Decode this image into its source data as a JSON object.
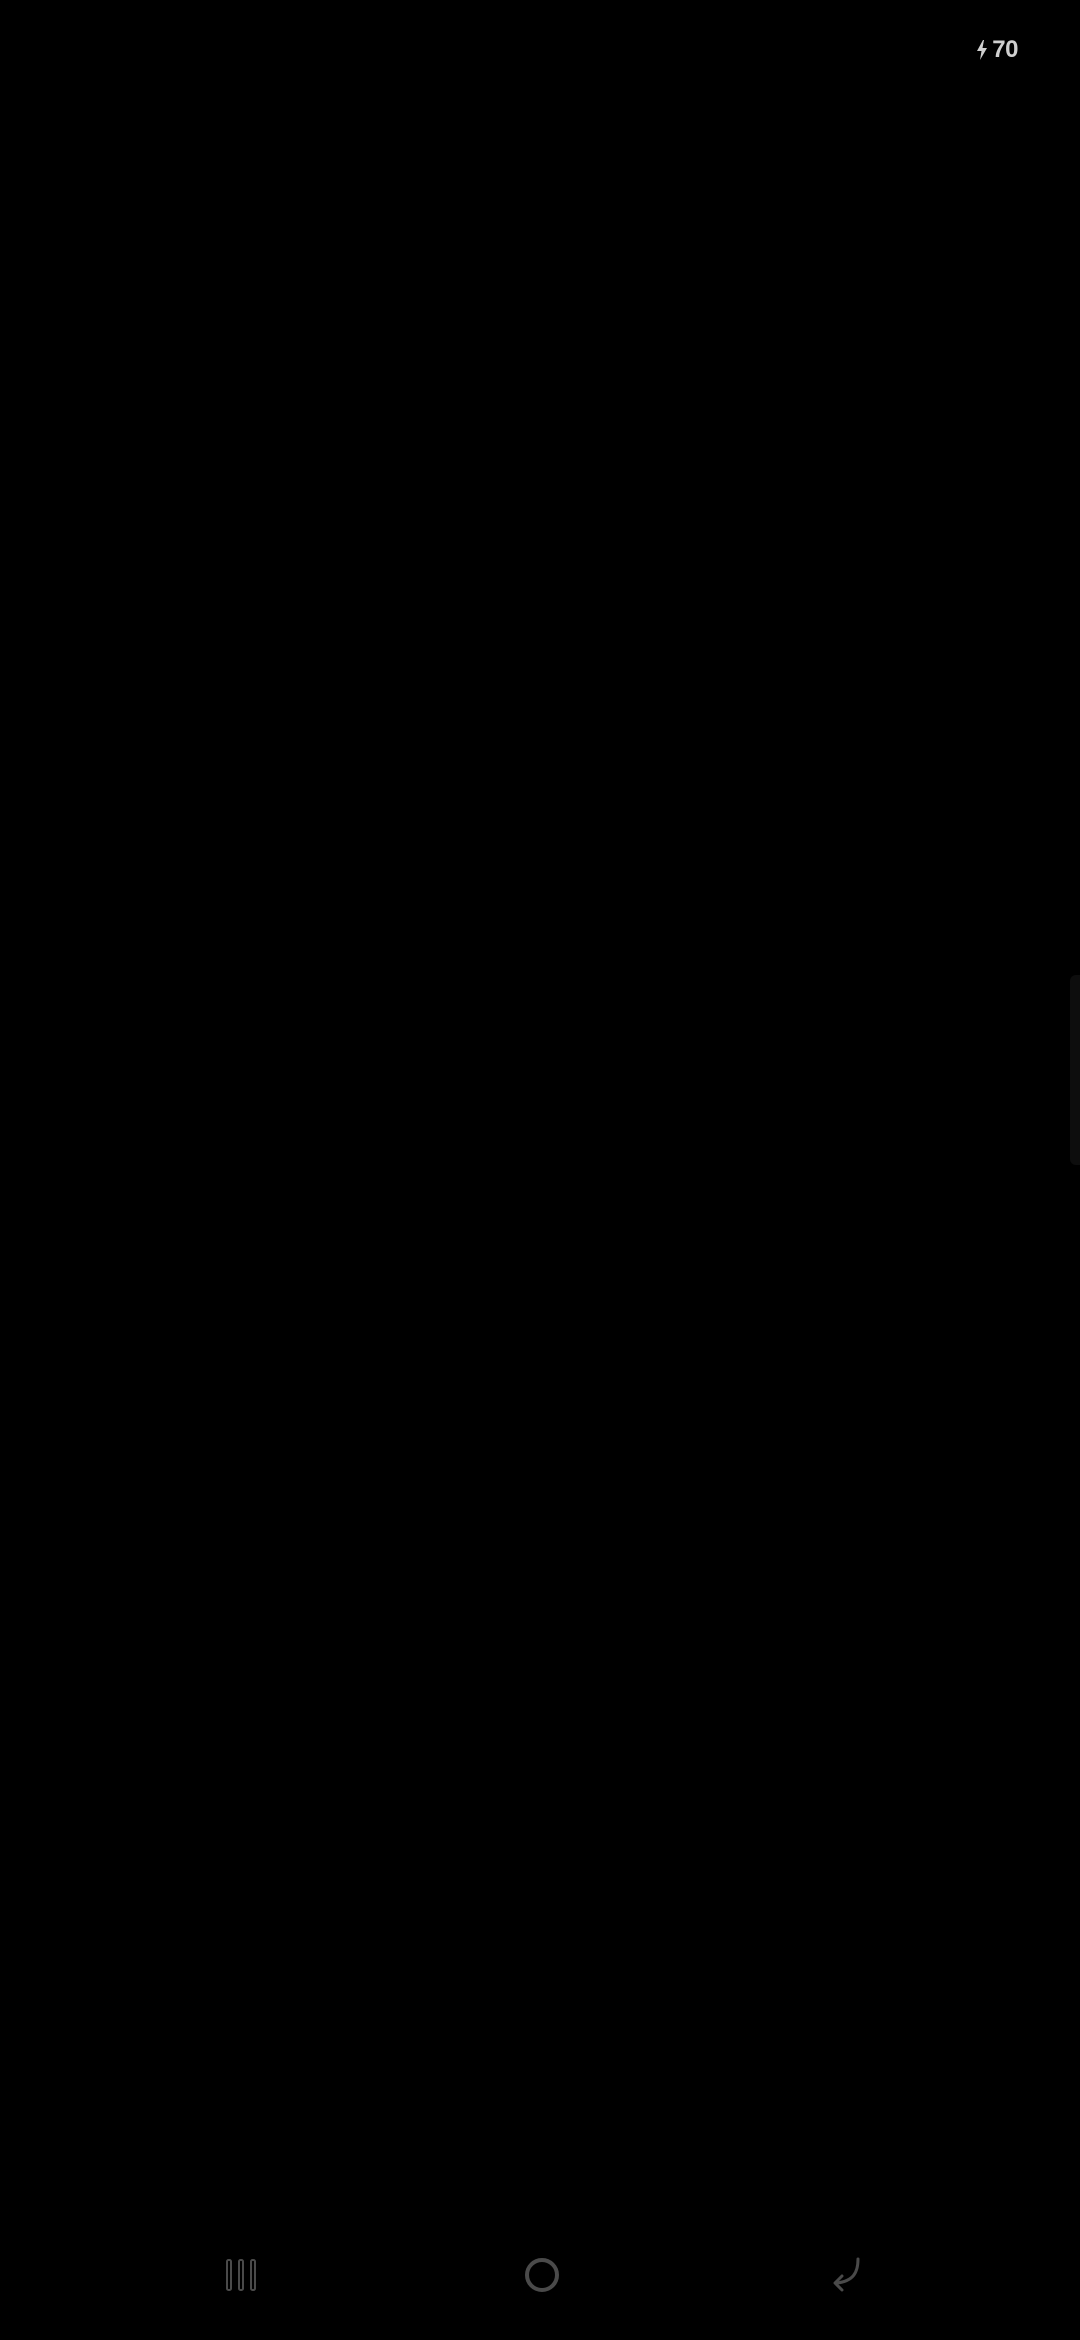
{
  "status_bar": {
    "battery_level": "70",
    "charging_icon": "bolt-icon"
  },
  "navigation_bar": {
    "recents_icon": "recents-icon",
    "home_icon": "home-icon",
    "back_icon": "back-icon"
  },
  "colors": {
    "background": "#000000",
    "status_text": "#cfcfcf",
    "nav_icon": "#4a4a4a"
  }
}
